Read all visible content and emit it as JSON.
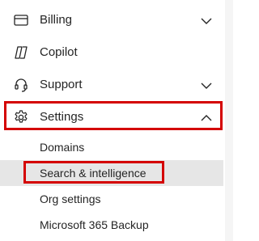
{
  "nav": {
    "items": [
      {
        "label": "Billing",
        "icon": "billing-icon",
        "expandable": true,
        "expanded": false
      },
      {
        "label": "Copilot",
        "icon": "copilot-icon",
        "expandable": false
      },
      {
        "label": "Support",
        "icon": "headset-icon",
        "expandable": true,
        "expanded": false
      },
      {
        "label": "Settings",
        "icon": "gear-icon",
        "expandable": true,
        "expanded": true
      }
    ],
    "settings_children": [
      {
        "label": "Domains"
      },
      {
        "label": "Search & intelligence",
        "selected": true
      },
      {
        "label": "Org settings"
      },
      {
        "label": "Microsoft 365 Backup"
      }
    ]
  },
  "colors": {
    "highlight": "#d40000",
    "selected_bg": "#e6e6e6",
    "text": "#242424"
  }
}
